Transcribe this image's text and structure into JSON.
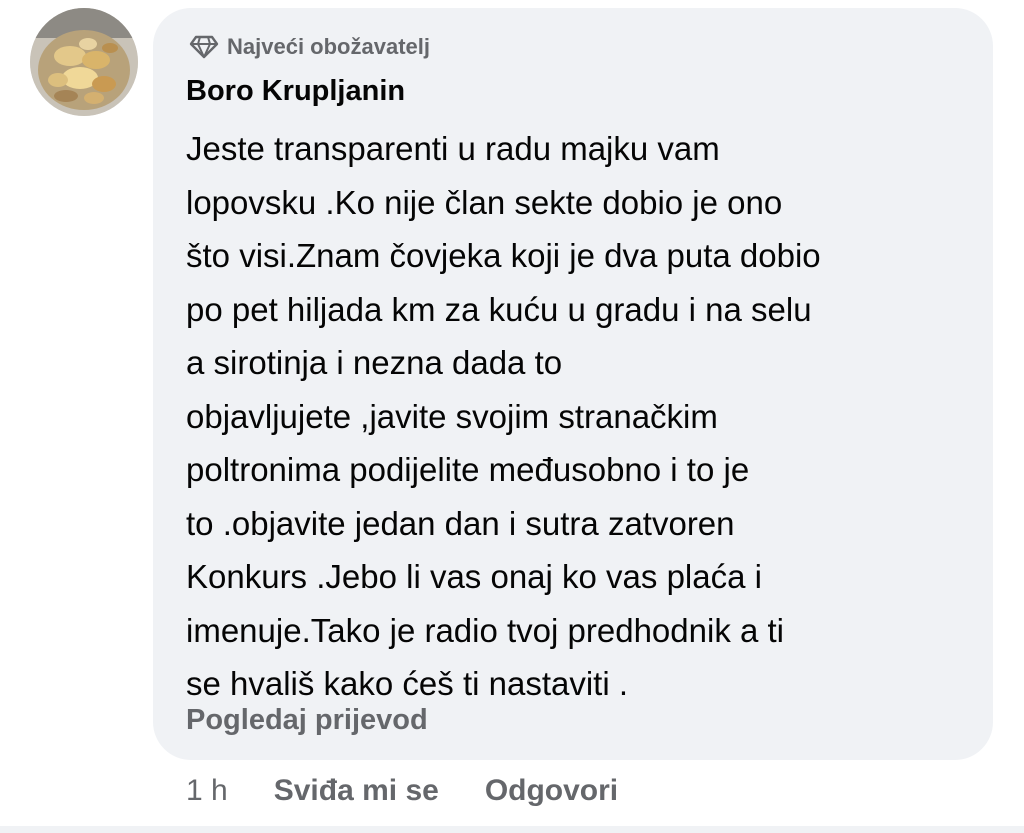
{
  "comment": {
    "avatar": "avatar-photo-icon",
    "badge": {
      "icon": "diamond-icon",
      "label": "Najveći obožavatelj"
    },
    "author": "Boro Krupljanin",
    "text_lines": [
      "Jeste transparenti u radu majku vam",
      "lopovsku .Ko nije član sekte dobio je ono",
      "što visi.Znam čovjeka koji je dva puta dobio",
      "po pet hiljada km za kuću u gradu i na selu",
      "a sirotinja i nezna dada to",
      "objavljujete ,javite svojim stranačkim",
      "poltronima podijelite međusobno i to je",
      "to .objavite jedan dan i sutra zatvoren",
      "Konkurs .Jebo li vas onaj ko vas plaća i",
      "imenuje.Tako je radio tvoj predhodnik a ti",
      "se hvališ kako ćeš ti nastaviti ."
    ],
    "translate_label": "Pogledaj prijevod"
  },
  "actions": {
    "time": "1 h",
    "like_label": "Sviđa mi se",
    "reply_label": "Odgovori"
  },
  "colors": {
    "bubble_bg": "#f0f2f5",
    "text": "#050505",
    "secondary_text": "#65676b"
  }
}
